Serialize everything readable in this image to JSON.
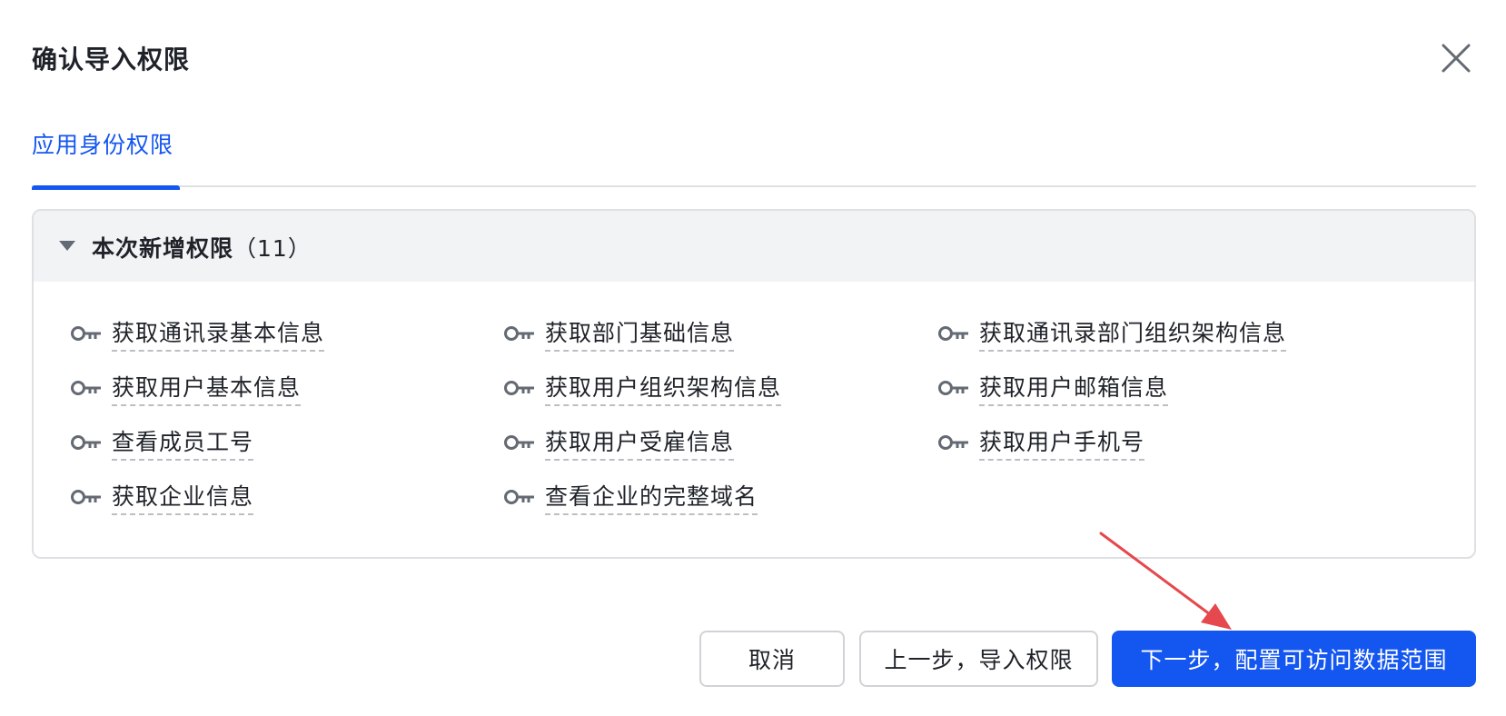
{
  "dialog": {
    "title": "确认导入权限",
    "close_icon": "close-icon"
  },
  "tabs": [
    {
      "label": "应用身份权限",
      "active": true
    }
  ],
  "panel": {
    "title": "本次新增权限",
    "count": "（11）",
    "expanded": true,
    "items": [
      {
        "label": "获取通讯录基本信息"
      },
      {
        "label": "获取部门基础信息"
      },
      {
        "label": "获取通讯录部门组织架构信息"
      },
      {
        "label": "获取用户基本信息"
      },
      {
        "label": "获取用户组织架构信息"
      },
      {
        "label": "获取用户邮箱信息"
      },
      {
        "label": "查看成员工号"
      },
      {
        "label": "获取用户受雇信息"
      },
      {
        "label": "获取用户手机号"
      },
      {
        "label": "获取企业信息"
      },
      {
        "label": "查看企业的完整域名"
      }
    ]
  },
  "footer": {
    "cancel_label": "取消",
    "prev_label": "上一步，导入权限",
    "next_label": "下一步，配置可访问数据范围"
  },
  "colors": {
    "accent": "#1456f0",
    "annotation_arrow": "#e5484d"
  }
}
